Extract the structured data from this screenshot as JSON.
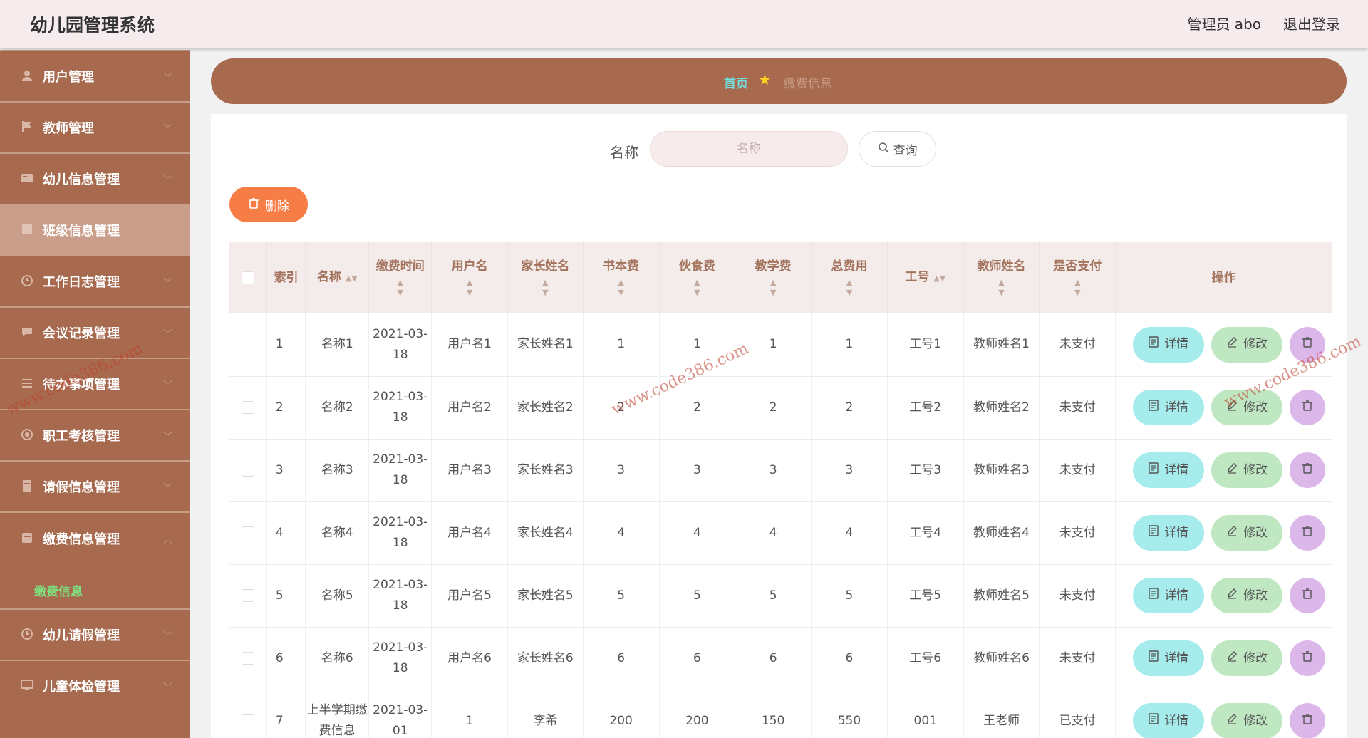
{
  "header": {
    "title": "幼儿园管理系统",
    "admin_label": "管理员 abo",
    "logout": "退出登录"
  },
  "sidebar": {
    "items": [
      {
        "label": "用户管理",
        "icon": "user-icon"
      },
      {
        "label": "教师管理",
        "icon": "flag-icon"
      },
      {
        "label": "幼儿信息管理",
        "icon": "card-icon"
      },
      {
        "label": "班级信息管理",
        "icon": "grid-icon"
      },
      {
        "label": "工作日志管理",
        "icon": "clock-icon"
      },
      {
        "label": "会议记录管理",
        "icon": "chat-icon"
      },
      {
        "label": "待办事项管理",
        "icon": "list-icon"
      },
      {
        "label": "职工考核管理",
        "icon": "target-icon"
      },
      {
        "label": "请假信息管理",
        "icon": "doc-icon"
      }
    ],
    "group": {
      "label": "缴费信息管理",
      "icon": "wallet-icon",
      "sub": "缴费信息"
    },
    "items_after": [
      {
        "label": "幼儿请假管理",
        "icon": "clock-icon"
      },
      {
        "label": "儿童体检管理",
        "icon": "monitor-icon"
      }
    ]
  },
  "breadcrumb": {
    "home": "首页",
    "current": "缴费信息"
  },
  "search": {
    "label": "名称",
    "placeholder": "名称",
    "button": "查询"
  },
  "toolbar": {
    "delete": "删除"
  },
  "table": {
    "headers": [
      "索引",
      "名称",
      "缴费时间",
      "用户名",
      "家长姓名",
      "书本费",
      "伙食费",
      "教学费",
      "总费用",
      "工号",
      "教师姓名",
      "是否支付",
      "操作"
    ],
    "rows": [
      [
        "1",
        "名称1",
        "2021-03-18",
        "用户名1",
        "家长姓名1",
        "1",
        "1",
        "1",
        "1",
        "工号1",
        "教师姓名1",
        "未支付"
      ],
      [
        "2",
        "名称2",
        "2021-03-18",
        "用户名2",
        "家长姓名2",
        "2",
        "2",
        "2",
        "2",
        "工号2",
        "教师姓名2",
        "未支付"
      ],
      [
        "3",
        "名称3",
        "2021-03-18",
        "用户名3",
        "家长姓名3",
        "3",
        "3",
        "3",
        "3",
        "工号3",
        "教师姓名3",
        "未支付"
      ],
      [
        "4",
        "名称4",
        "2021-03-18",
        "用户名4",
        "家长姓名4",
        "4",
        "4",
        "4",
        "4",
        "工号4",
        "教师姓名4",
        "未支付"
      ],
      [
        "5",
        "名称5",
        "2021-03-18",
        "用户名5",
        "家长姓名5",
        "5",
        "5",
        "5",
        "5",
        "工号5",
        "教师姓名5",
        "未支付"
      ],
      [
        "6",
        "名称6",
        "2021-03-18",
        "用户名6",
        "家长姓名6",
        "6",
        "6",
        "6",
        "6",
        "工号6",
        "教师姓名6",
        "未支付"
      ],
      [
        "7",
        "上半学期缴费信息",
        "2021-03-01",
        "1",
        "李希",
        "200",
        "200",
        "150",
        "550",
        "001",
        "王老师",
        "已支付"
      ]
    ],
    "actions": {
      "detail": "详情",
      "edit": "修改"
    }
  },
  "watermark": "www.code386.com",
  "colors": {
    "sidebar": "#a76a4f",
    "accent_cyan": "#6fe1e1",
    "delete_orange": "#f77d46",
    "detail_btn": "#a7ecec",
    "edit_btn": "#bfe8c2",
    "delete_btn": "#dcb8ea"
  }
}
